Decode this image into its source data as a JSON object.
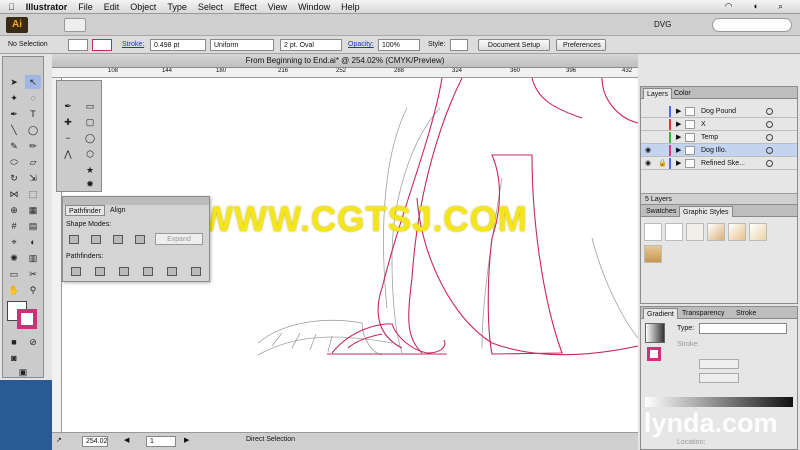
{
  "menubar": {
    "app": "Illustrator",
    "items": [
      "File",
      "Edit",
      "Object",
      "Type",
      "Select",
      "Effect",
      "View",
      "Window",
      "Help"
    ]
  },
  "appbar": {
    "logo": "Ai",
    "workspace": "DVG"
  },
  "controlbar": {
    "selection": "No Selection",
    "stroke_label": "Stroke:",
    "stroke_weight": "0.498 pt",
    "profile": "Uniform",
    "brush": "2 pt. Oval",
    "opacity_label": "Opacity:",
    "opacity": "100%",
    "style_label": "Style:",
    "doc_setup": "Document Setup",
    "preferences": "Preferences"
  },
  "document": {
    "tab_title": "From Beginning to End.ai* @ 254.02% (CMYK/Preview)",
    "ruler_ticks": [
      "108",
      "144",
      "180",
      "216",
      "252",
      "288",
      "324",
      "360",
      "396",
      "432"
    ]
  },
  "pathfinder": {
    "tabs": [
      "Pathfinder",
      "Align"
    ],
    "shape_modes": "Shape Modes:",
    "expand": "Expand",
    "pathfinders": "Pathfinders:"
  },
  "layers": {
    "tabs": [
      "Layers",
      "Color"
    ],
    "rows": [
      {
        "name": "Dog Pound",
        "color": "#4f6de0",
        "selected": false
      },
      {
        "name": "X",
        "color": "#d23c3c",
        "selected": false
      },
      {
        "name": "Temp",
        "color": "#3cb43c",
        "selected": false
      },
      {
        "name": "Dog Illo.",
        "color": "#d23c8c",
        "selected": true
      },
      {
        "name": "Refined Ske...",
        "color": "#4f6de0",
        "selected": false
      }
    ],
    "count": "5 Layers"
  },
  "swatches": {
    "tabs": [
      "Swatches",
      "Graphic Styles"
    ]
  },
  "gradient": {
    "tabs": [
      "Gradient",
      "Transparency",
      "Stroke"
    ],
    "type_label": "Type:",
    "stroke_label": "Stroke:",
    "location_label": "Location:"
  },
  "status": {
    "zoom": "254.02",
    "artboard": "1",
    "tool": "Direct Selection"
  },
  "watermark": "WWW.CGTSJ.COM",
  "brand": "lynda.com",
  "colors": {
    "path": "#c8285a",
    "sketch": "#9a9a9a",
    "accent": "#1a3ea8"
  }
}
